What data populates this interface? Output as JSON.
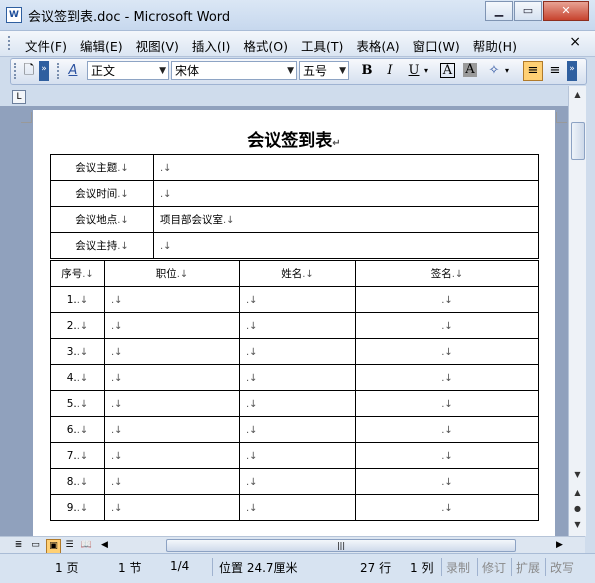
{
  "window": {
    "title": "会议签到表.doc - Microsoft Word",
    "app_icon": "W",
    "min_icon": "minimize-icon",
    "max_icon": "maximize-icon",
    "close_icon": "close-icon"
  },
  "menu": {
    "items": [
      "文件(F)",
      "编辑(E)",
      "视图(V)",
      "插入(I)",
      "格式(O)",
      "工具(T)",
      "表格(A)",
      "窗口(W)",
      "帮助(H)"
    ],
    "close": "×"
  },
  "toolbar": {
    "style_value": "正文",
    "font_value": "宋体",
    "size_value": "五号",
    "bold": "B",
    "italic": "I",
    "underline": "U",
    "char_border": "A",
    "char_shade": "A"
  },
  "ruler_corner": "L",
  "document": {
    "title": "会议签到表",
    "para_mark": "↵",
    "cell_mark": ".↓",
    "info_rows": [
      {
        "label": "会议主题",
        "value": ""
      },
      {
        "label": "会议时间",
        "value": ""
      },
      {
        "label": "会议地点",
        "value": "项目部会议室"
      },
      {
        "label": "会议主持",
        "value": ""
      }
    ],
    "columns": [
      "序号",
      "职位",
      "姓名",
      "签名"
    ],
    "row_numbers": [
      "1.",
      "2.",
      "3.",
      "4.",
      "5.",
      "6.",
      "7.",
      "8.",
      "9."
    ]
  },
  "status": {
    "page": "1 页",
    "section": "1 节",
    "page_of": "1/4",
    "position": "位置 24.7厘米",
    "line": "27 行",
    "column": "1 列",
    "rec": "录制",
    "trk": "修订",
    "ext": "扩展",
    "ovr": "改写"
  },
  "colors": {
    "accent": "#ffd074",
    "close_button": "#c7432e",
    "chrome": "#cfdcec"
  }
}
